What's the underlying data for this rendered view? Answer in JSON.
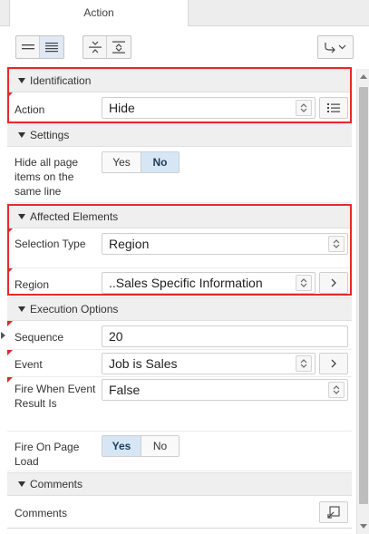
{
  "tab": {
    "label": "Action"
  },
  "toolbar": {
    "buttons": [
      {
        "icon": "collapse-all-icon",
        "active": false
      },
      {
        "icon": "show-common-icon",
        "active": true
      },
      {
        "icon": "collapse-groups-icon",
        "active": false
      },
      {
        "icon": "expand-groups-icon",
        "active": false
      }
    ],
    "goto_icon": "go-to-group-icon"
  },
  "groups": {
    "identification": "Identification",
    "settings": "Settings",
    "affected_elements": "Affected Elements",
    "execution_options": "Execution Options",
    "comments": "Comments"
  },
  "identification": {
    "action_label": "Action",
    "action_value": "Hide"
  },
  "settings": {
    "hide_label": "Hide all page items on the same line",
    "yes": "Yes",
    "no": "No",
    "selected": "No"
  },
  "affected": {
    "selection_type_label": "Selection Type",
    "selection_type_value": "Region",
    "region_label": "Region",
    "region_value": "..Sales Specific Information"
  },
  "execution": {
    "sequence_label": "Sequence",
    "sequence_value": "20",
    "event_label": "Event",
    "event_value": "Job is Sales",
    "fire_when_label": "Fire When Event Result Is",
    "fire_when_value": "False",
    "fire_on_load_label": "Fire On Page Load",
    "yes": "Yes",
    "no": "No",
    "selected": "Yes"
  },
  "comments": {
    "comments_label": "Comments"
  },
  "colors": {
    "highlight": "#e8282b",
    "required_marker": "#d62a2a",
    "toggle_on": "#d6e6f5"
  }
}
